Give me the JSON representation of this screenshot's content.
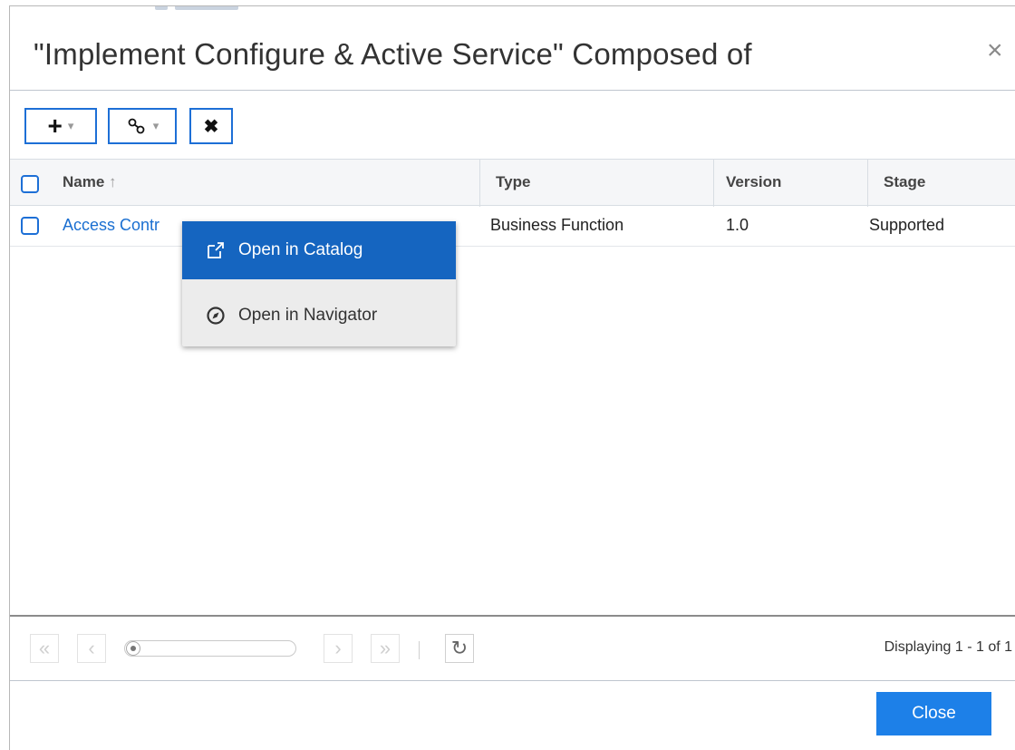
{
  "dialog": {
    "title": "\"Implement Configure & Active Service\" Composed of",
    "close_glyph": "×"
  },
  "toolbar": {
    "add_glyph": "+",
    "link_glyph": "%",
    "caret_glyph": "▾",
    "remove_glyph": "✖"
  },
  "grid": {
    "columns": [
      {
        "label": "Name",
        "sort": "ascending"
      },
      {
        "label": "Type"
      },
      {
        "label": "Version"
      },
      {
        "label": "Stage"
      }
    ],
    "sort_icon": "↑",
    "rows": [
      {
        "name": "Access Contr",
        "type": "Business Function",
        "version": "1.0",
        "stage": "Supported"
      }
    ]
  },
  "context_menu": {
    "items": [
      {
        "label": "Open in Catalog",
        "icon": "external-link-icon",
        "active": true
      },
      {
        "label": "Open in Navigator",
        "icon": "compass-icon",
        "active": false
      }
    ]
  },
  "pager": {
    "first_glyph": "«",
    "prev_glyph": "‹",
    "next_glyph": "›",
    "last_glyph": "»",
    "refresh_glyph": "↻",
    "status": "Displaying 1 - 1 of 1"
  },
  "footer": {
    "close_label": "Close"
  },
  "colors": {
    "accent": "#1d6fd6",
    "menu_active": "#1565c0",
    "link": "#1a6fd1",
    "primary_button": "#1d80e8"
  }
}
